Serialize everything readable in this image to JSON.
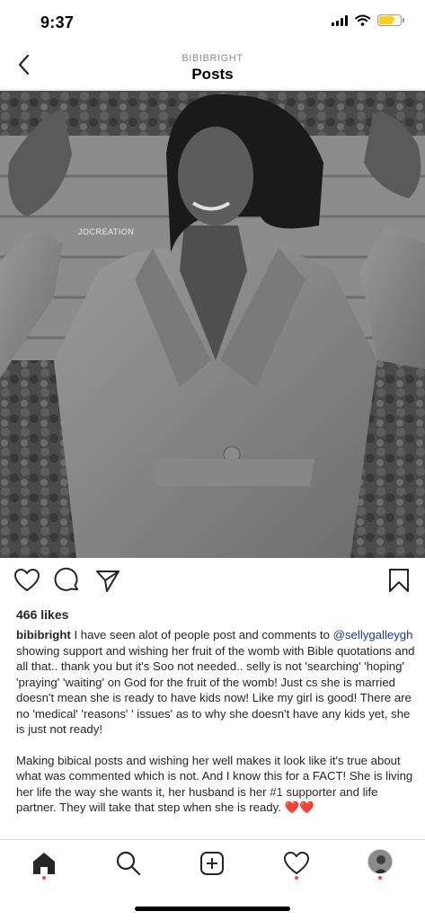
{
  "status_bar": {
    "time": "9:37",
    "battery_level": 0.65,
    "battery_color": "#f5d223"
  },
  "header": {
    "username": "BIBIBRIGHT",
    "title": "Posts"
  },
  "post": {
    "watermark": "JOCREATION",
    "likes": "466 likes",
    "caption_user": "bibibright",
    "caption_part1": " I have seen alot of people post and comments to ",
    "mention": "@sellygalleygh",
    "caption_part2": " showing support and wishing her fruit of the womb with Bible quotations and all that.. thank you but it's Soo not needed.. selly is not 'searching' 'hoping' 'praying' 'waiting' on God for the fruit of the womb! Just cs she is married doesn't mean she is ready to have kids now! Like my girl is good! There are no 'medical' 'reasons' ' issues' as to why she doesn't have any kids yet, she is just not ready!",
    "caption_p2_part1": "Making bibical  posts and wishing her well makes it look like it's true about what was commented which is not. And I know this for a FACT! She is living her life the way she wants it, her husband is her ",
    "hashtag": "#1",
    "caption_p2_part2": " supporter and life partner. They will take that step when she is ready. ",
    "emoji": "❤️❤️"
  },
  "icons": {
    "back": "chevron-left-icon",
    "like": "heart-icon",
    "comment": "comment-icon",
    "share": "send-icon",
    "save": "bookmark-icon",
    "home": "home-icon",
    "search": "search-icon",
    "new_post": "add-post-icon",
    "activity": "heart-icon",
    "profile": "avatar"
  },
  "colors": {
    "mention": "#1e3a8a",
    "notification_dot": "#ed4956"
  }
}
